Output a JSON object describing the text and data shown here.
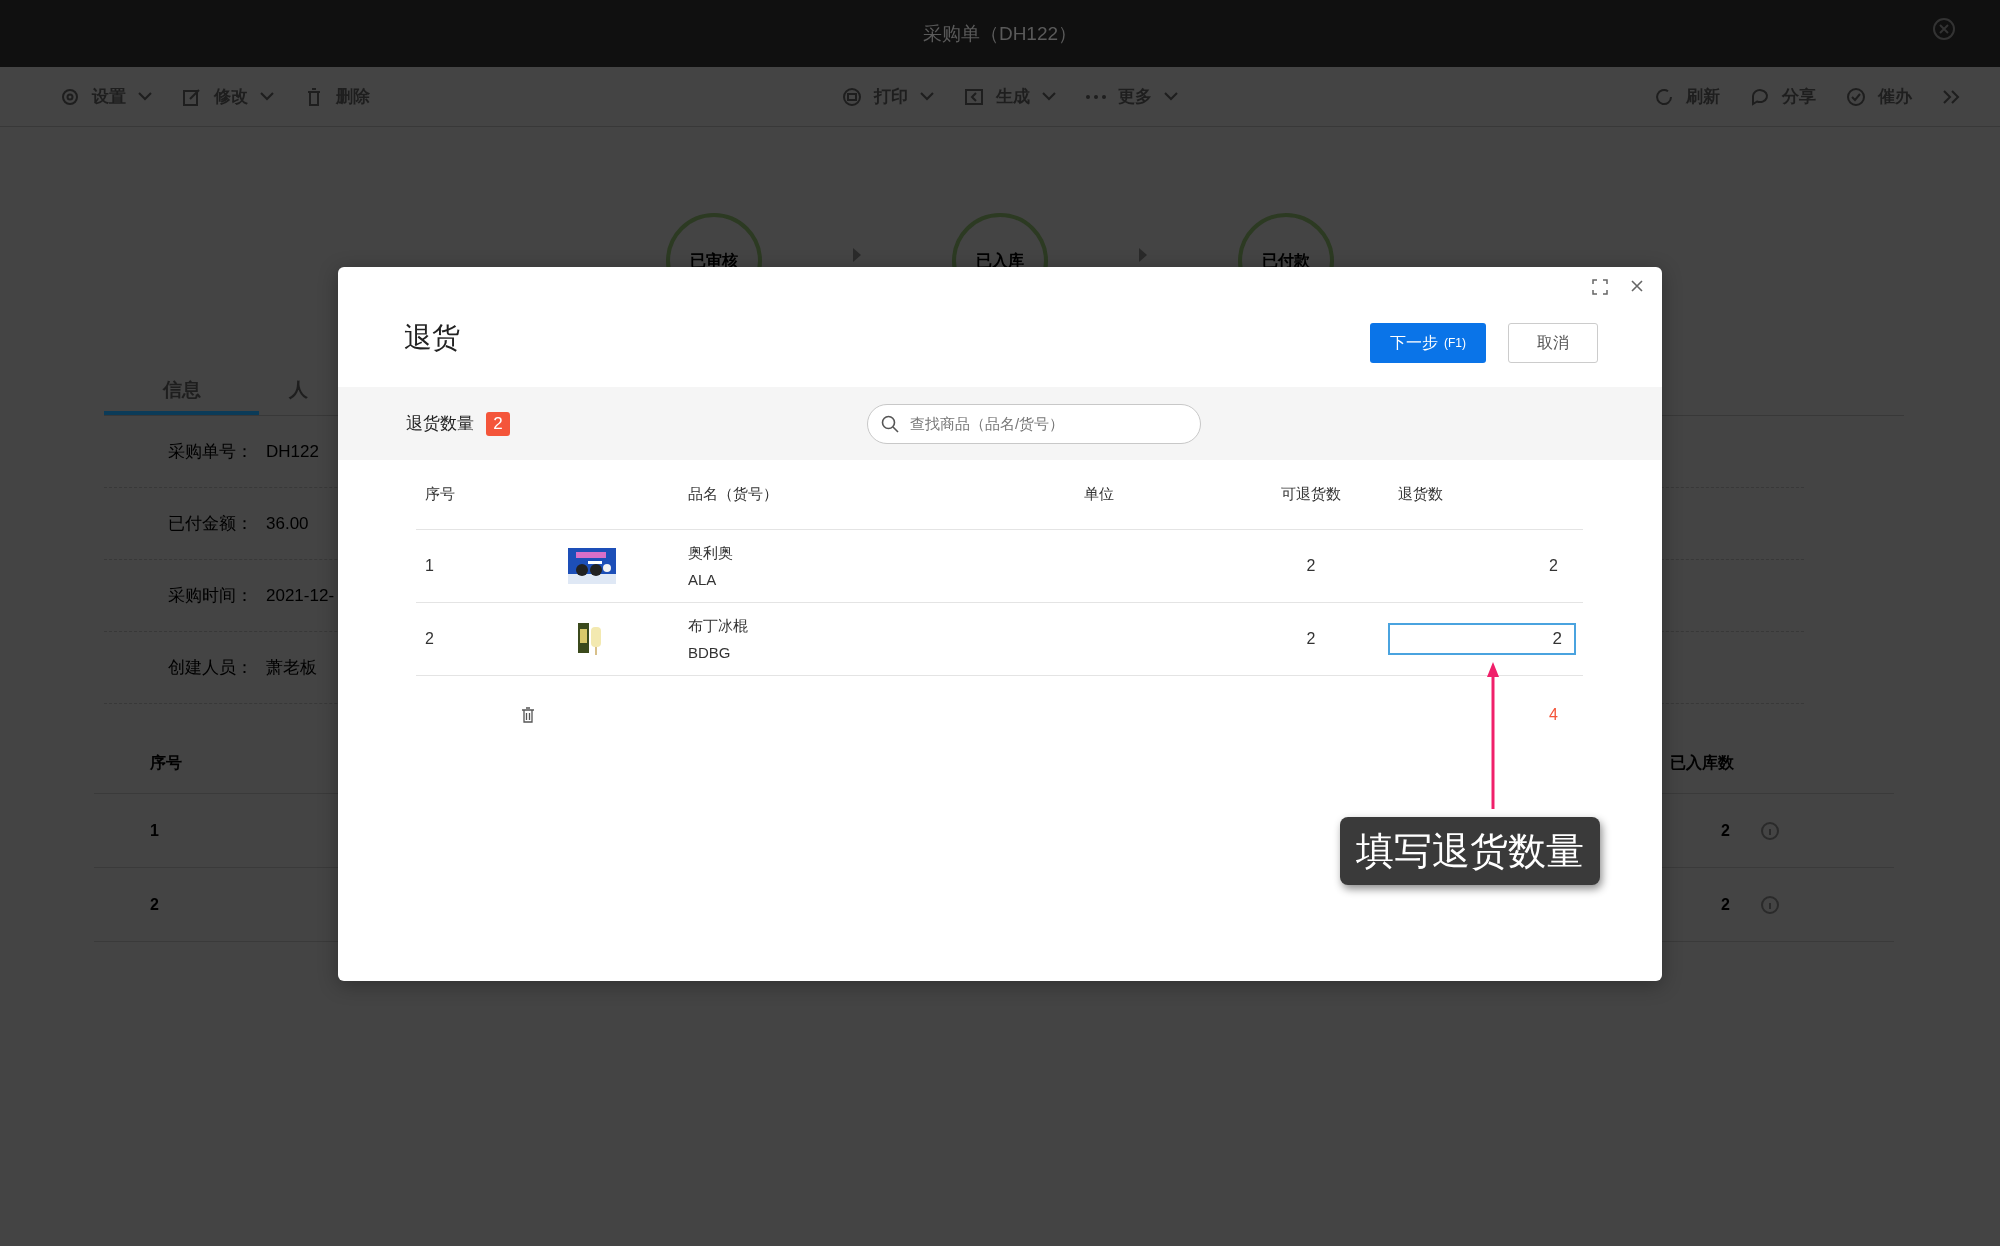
{
  "window": {
    "title": "采购单（DH122）"
  },
  "toolbar": {
    "left": [
      {
        "label": "设置",
        "dropdown": true
      },
      {
        "label": "修改",
        "dropdown": true
      },
      {
        "label": "删除",
        "dropdown": false
      }
    ],
    "center": [
      {
        "label": "打印",
        "dropdown": true
      },
      {
        "label": "生成",
        "dropdown": true
      },
      {
        "label": "更多",
        "dropdown": true
      }
    ],
    "right": [
      {
        "label": "刷新"
      },
      {
        "label": "分享"
      },
      {
        "label": "催办"
      }
    ]
  },
  "status_steps": [
    {
      "label": "已审核"
    },
    {
      "label": "已入库"
    },
    {
      "label": "已付款"
    }
  ],
  "tabs": [
    {
      "label": "信息",
      "selected": true
    },
    {
      "label": "人",
      "selected": false
    }
  ],
  "info": [
    {
      "label": "采购单号：",
      "value": "DH122"
    },
    {
      "label": "已付金额：",
      "value": "36.00"
    },
    {
      "label": "采购时间：",
      "value": "2021-12-"
    },
    {
      "label": "创建人员：",
      "value": "萧老板"
    }
  ],
  "background_table": {
    "columns": [
      "序号",
      "已入库数"
    ],
    "rows": [
      {
        "index": "1",
        "received": "2"
      },
      {
        "index": "2",
        "received": "2"
      }
    ]
  },
  "dialog": {
    "title": "退货",
    "primary_button": "下一步",
    "primary_shortcut": "(F1)",
    "cancel_button": "取消",
    "count_label": "退货数量",
    "count_badge": "2",
    "search": {
      "placeholder": "查找商品（品名/货号）"
    },
    "columns": [
      "序号",
      "品名（货号）",
      "单位",
      "可退货数",
      "退货数"
    ],
    "rows": [
      {
        "index": "1",
        "name": "奥利奥",
        "code": "ALA",
        "available": "2",
        "quantity": "2",
        "editing": false,
        "kind": "box"
      },
      {
        "index": "2",
        "name": "布丁冰棍",
        "code": "BDBG",
        "available": "2",
        "quantity": "2",
        "editing": true,
        "kind": "bar"
      }
    ],
    "total": "4"
  },
  "annotation": {
    "text": "填写退货数量"
  }
}
